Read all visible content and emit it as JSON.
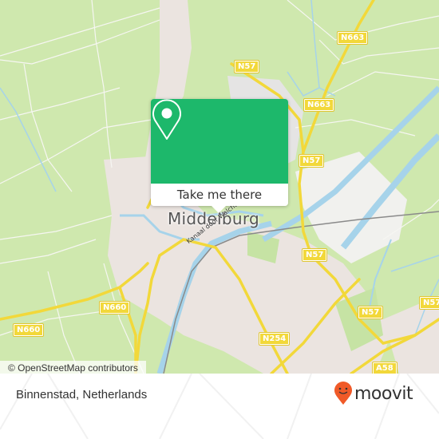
{
  "map": {
    "city_label": "Middelburg",
    "canal_label": "Kanaal door Walcheren",
    "road_shields": [
      "N663",
      "N57",
      "N663",
      "N57",
      "N57",
      "N57",
      "N57",
      "N254",
      "N660",
      "N660",
      "A58"
    ],
    "attribution": "© OpenStreetMap contributors",
    "colors": {
      "land": "#cfe8ae",
      "urban": "#ebe4e0",
      "water": "#a6d3ea",
      "road": "#f2d83a",
      "accent": "#1db86b"
    }
  },
  "popup": {
    "pin_icon": "map-pin-icon",
    "action_label": "Take me there"
  },
  "footer": {
    "place_name": "Binnenstad, Netherlands",
    "brand_name": "moovit",
    "brand_color": "#f05a28"
  }
}
